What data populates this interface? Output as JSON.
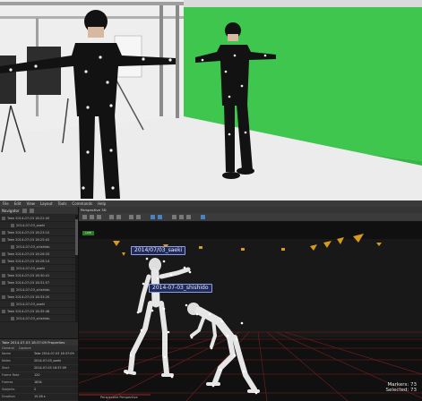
{
  "menubar": {
    "items": [
      "File",
      "Edit",
      "View",
      "Layout",
      "Tools",
      "Commands",
      "Help"
    ]
  },
  "left_panel": {
    "header_label": "Navigator",
    "takes": [
      {
        "label": "Take 2014-07-03 18:22:45",
        "sub": false,
        "selected": false
      },
      {
        "label": "2014-07-03_saeki",
        "sub": true,
        "selected": false
      },
      {
        "label": "Take 2014-07-03 18:23:10",
        "sub": false,
        "selected": false
      },
      {
        "label": "Take 2014-07-03 18:25:02",
        "sub": false,
        "selected": false
      },
      {
        "label": "2014-07-03_shishido",
        "sub": true,
        "selected": false
      },
      {
        "label": "Take 2014-07-03 18:26:33",
        "sub": false,
        "selected": false
      },
      {
        "label": "Take 2014-07-03 18:28:14",
        "sub": false,
        "selected": false
      },
      {
        "label": "2014-07-03_saeki",
        "sub": true,
        "selected": false
      },
      {
        "label": "Take 2014-07-03 18:30:41",
        "sub": false,
        "selected": false
      },
      {
        "label": "Take 2014-07-03 18:31:57",
        "sub": false,
        "selected": false
      },
      {
        "label": "2014-07-03_shishido",
        "sub": true,
        "selected": false
      },
      {
        "label": "Take 2014-07-03 18:33:20",
        "sub": false,
        "selected": false
      },
      {
        "label": "2014-07-03_saeki",
        "sub": true,
        "selected": false
      },
      {
        "label": "Take 2014-07-03 18:35:48",
        "sub": false,
        "selected": false
      },
      {
        "label": "2014-07-03_shishido",
        "sub": true,
        "selected": false
      },
      {
        "label": "Take 2014-07-03 18:37:09",
        "sub": false,
        "selected": true
      },
      {
        "label": "2014-07-03_saeki",
        "sub": true,
        "selected": false
      }
    ]
  },
  "properties": {
    "title": "Take 2014-07-03 18:37:09 Properties",
    "tabs": [
      "General",
      "Capture"
    ],
    "rows": [
      {
        "k": "Name",
        "v": "Take 2014-07-03 18:37:09"
      },
      {
        "k": "Notes",
        "v": "2014-07-03_saeki"
      },
      {
        "k": "Start",
        "v": "2014-07-03 18:37:09"
      },
      {
        "k": "Frame Rate",
        "v": "120"
      },
      {
        "k": "Frames",
        "v": "1834"
      },
      {
        "k": "Subjects",
        "v": "2"
      },
      {
        "k": "Duration",
        "v": "15.28 s"
      },
      {
        "k": "Size",
        "v": "42.6 MB"
      }
    ]
  },
  "viewport": {
    "tab_label": "Perspective 3D",
    "live_label": "LIVE",
    "subject_1": "2014/07/03_saeki",
    "subject_2": "2014-07-03_shishido",
    "markers_line": "Markers: 73",
    "selected_line": "Selected: 73",
    "perspective_label": "Perspective Perspective"
  }
}
